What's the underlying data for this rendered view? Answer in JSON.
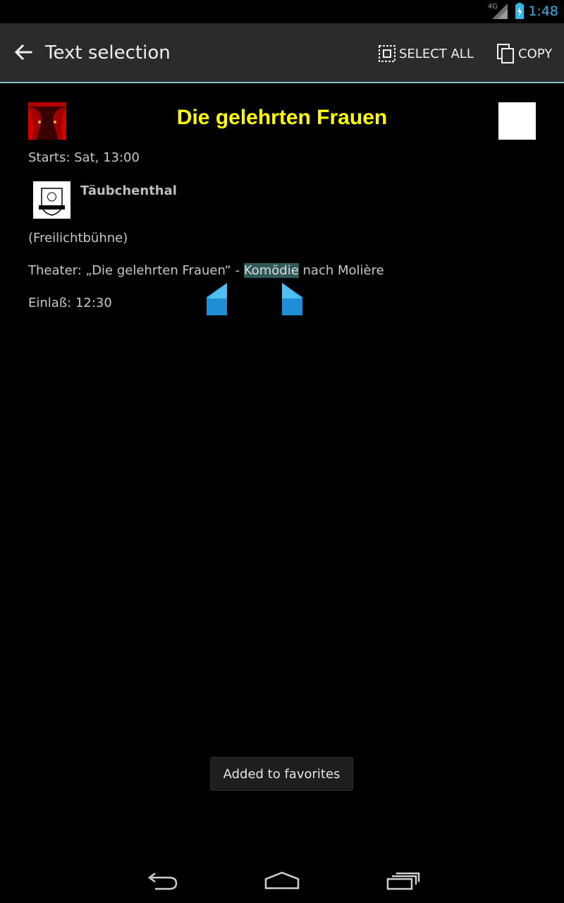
{
  "status_bar": {
    "network_label": "4G",
    "time": "1:48",
    "accent_color": "#33b5e5"
  },
  "action_bar": {
    "title": "Text selection",
    "select_all_label": "SELECT ALL",
    "copy_label": "COPY",
    "icons": [
      "back-arrow-icon",
      "select-all-icon",
      "copy-icon"
    ]
  },
  "event": {
    "title": "Die gelehrten Frauen",
    "title_color": "#ffff00",
    "starts": "Starts: Sat, 13:00",
    "venue_name": "Täubchenthal",
    "venue_sub": "(Freilichtbühne)",
    "description_before": "Theater: „Die gelehrten Frauen“ - ",
    "description_selected": "Komödie",
    "description_after": " nach Molière",
    "admission": "Einlaß: 12:30"
  },
  "toast": {
    "message": "Added to favorites"
  },
  "nav_bar": {
    "icons": [
      "back-icon",
      "home-icon",
      "recent-apps-icon"
    ]
  }
}
